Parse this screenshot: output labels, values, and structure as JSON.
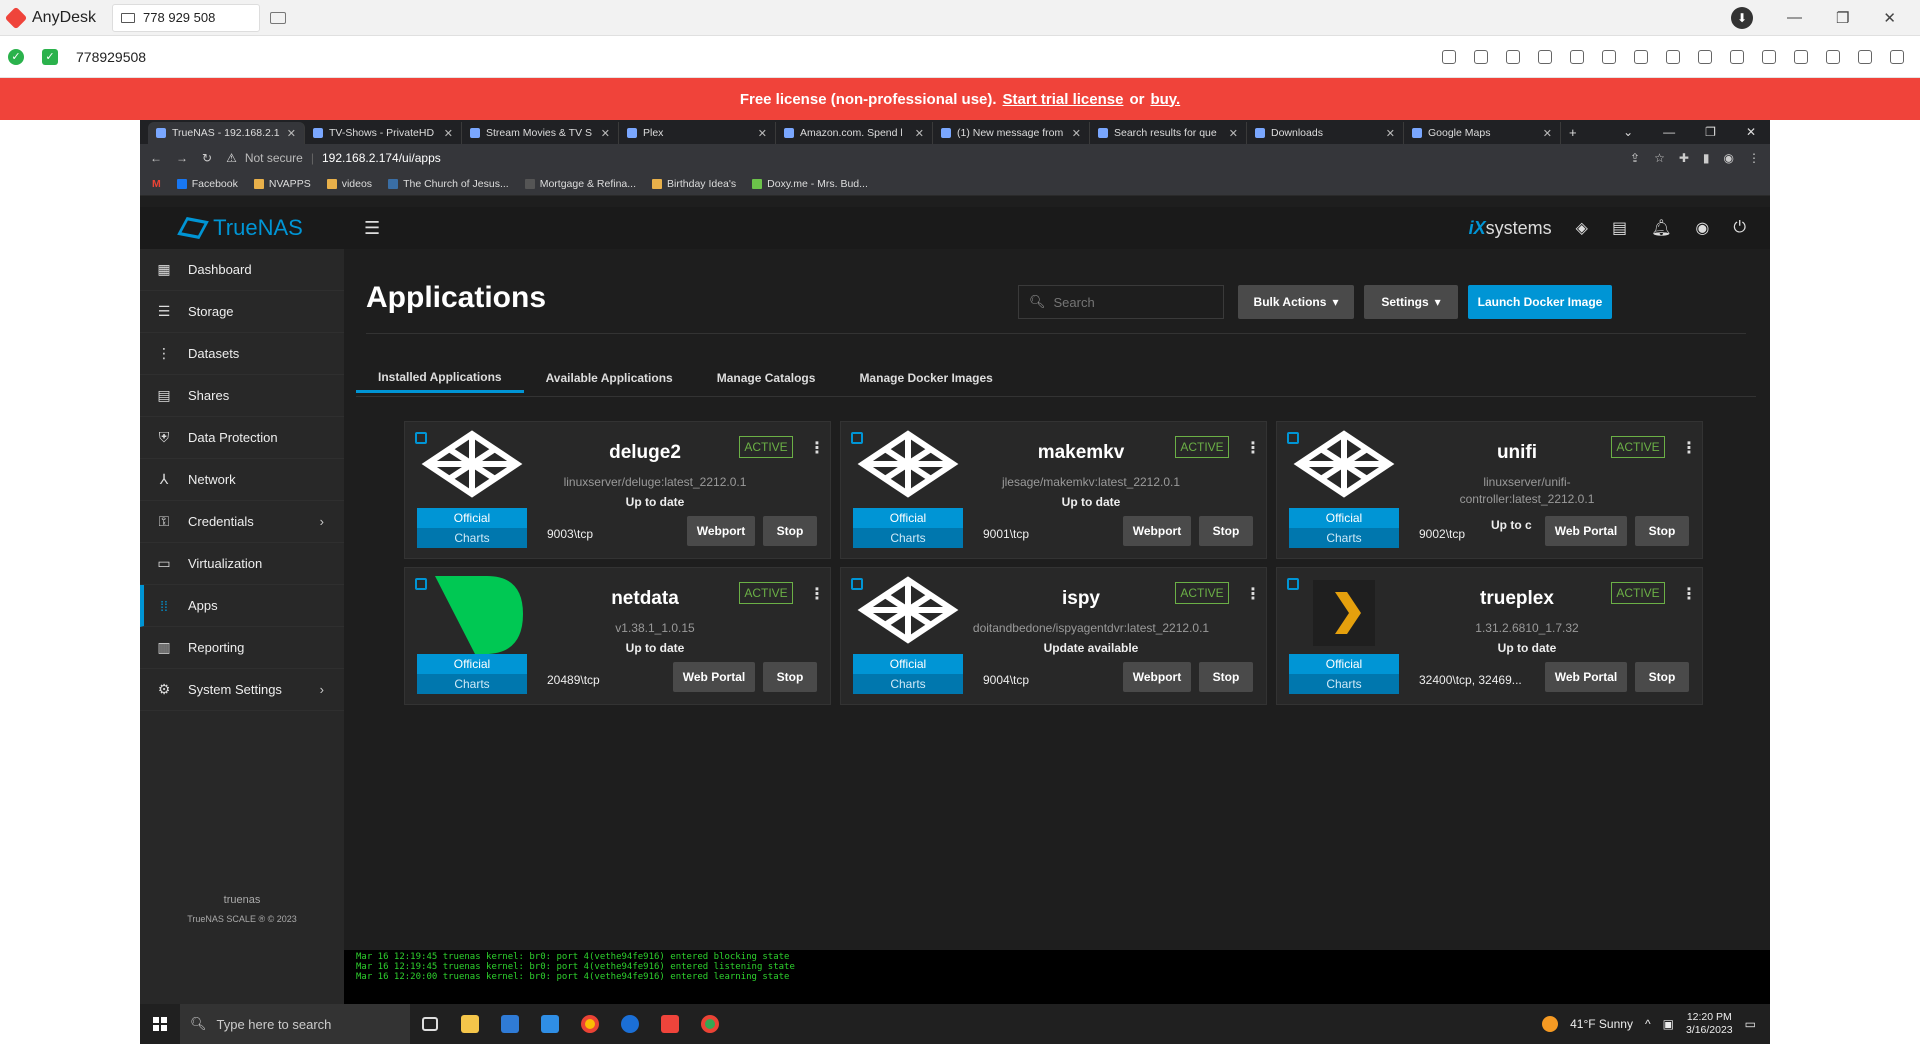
{
  "anydesk": {
    "app_name": "AnyDesk",
    "tab_label": "778 929 508",
    "remote_id": "778929508"
  },
  "license": {
    "text": "Free license (non-professional use).",
    "trial_link": "Start trial license",
    "or": "or",
    "buy_link": "buy."
  },
  "browser": {
    "tabs": [
      {
        "label": "TrueNAS - 192.168.2.1"
      },
      {
        "label": "TV-Shows - PrivateHD"
      },
      {
        "label": "Stream Movies & TV S"
      },
      {
        "label": "Plex"
      },
      {
        "label": "Amazon.com. Spend l"
      },
      {
        "label": "(1) New message from"
      },
      {
        "label": "Search results for que"
      },
      {
        "label": "Downloads"
      },
      {
        "label": "Google Maps"
      }
    ],
    "not_secure": "Not secure",
    "url": "192.168.2.174/ui/apps",
    "bookmarks": [
      "Facebook",
      "NVAPPS",
      "videos",
      "The Church of Jesus...",
      "Mortgage & Refina...",
      "Birthday Idea's",
      "Doxy.me - Mrs. Bud..."
    ]
  },
  "truenas": {
    "brand": "TrueNAS",
    "vendor_prefix": "iX",
    "vendor_suffix": "systems",
    "nav": [
      {
        "label": "Dashboard",
        "icon": "dashboard-icon",
        "glyph": "▦"
      },
      {
        "label": "Storage",
        "icon": "storage-icon",
        "glyph": "☰"
      },
      {
        "label": "Datasets",
        "icon": "datasets-icon",
        "glyph": "⋮"
      },
      {
        "label": "Shares",
        "icon": "shares-icon",
        "glyph": "▤"
      },
      {
        "label": "Data Protection",
        "icon": "shield-icon",
        "glyph": "⛨"
      },
      {
        "label": "Network",
        "icon": "network-icon",
        "glyph": "⅄"
      },
      {
        "label": "Credentials",
        "icon": "key-icon",
        "glyph": "⚿"
      },
      {
        "label": "Virtualization",
        "icon": "monitor-icon",
        "glyph": "▭"
      },
      {
        "label": "Apps",
        "icon": "apps-icon",
        "glyph": "⁞⁞"
      },
      {
        "label": "Reporting",
        "icon": "reporting-icon",
        "glyph": "▥"
      },
      {
        "label": "System Settings",
        "icon": "gear-icon",
        "glyph": "⚙"
      }
    ],
    "sidebar_host": "truenas",
    "copyright": "TrueNAS SCALE ® © 2023"
  },
  "apps_page": {
    "title": "Applications",
    "search_placeholder": "Search",
    "bulk_actions": "Bulk Actions",
    "settings": "Settings",
    "launch_docker": "Launch Docker Image",
    "tabs": [
      "Installed Applications",
      "Available Applications",
      "Manage Catalogs",
      "Manage Docker Images"
    ],
    "badge_official": "Official",
    "badge_charts": "Charts",
    "active_label": "ACTIVE",
    "stop_label": "Stop",
    "apps": [
      {
        "name": "deluge2",
        "image": "linuxserver/deluge:latest_2212.0.1",
        "status": "Up to date",
        "port": "9003\\tcp",
        "portal": "Webport"
      },
      {
        "name": "makemkv",
        "image": "jlesage/makemkv:latest_2212.0.1",
        "status": "Up to date",
        "port": "9001\\tcp",
        "portal": "Webport"
      },
      {
        "name": "unifi",
        "image": "linuxserver/unifi-controller:latest_2212.0.1",
        "status": "Up to c",
        "port": "9002\\tcp",
        "portal": "Web Portal"
      },
      {
        "name": "netdata",
        "image": "v1.38.1_1.0.15",
        "status": "Up to date",
        "port": "20489\\tcp",
        "portal": "Web Portal"
      },
      {
        "name": "ispy",
        "image": "doitandbedone/ispyagentdvr:latest_2212.0.1",
        "status": "Update available",
        "port": "9004\\tcp",
        "portal": "Webport"
      },
      {
        "name": "trueplex",
        "image": "1.31.2.6810_1.7.32",
        "status": "Up to date",
        "port": "32400\\tcp, 32469...",
        "portal": "Web Portal"
      }
    ]
  },
  "console": [
    "Mar 16 12:19:45 truenas kernel: br0: port 4(vethe94fe916) entered blocking state",
    "Mar 16 12:19:45 truenas kernel: br0: port 4(vethe94fe916) entered listening state",
    "Mar 16 12:20:00 truenas kernel: br0: port 4(vethe94fe916) entered learning state"
  ],
  "taskbar": {
    "search_placeholder": "Type here to search",
    "weather": "41°F  Sunny",
    "time": "12:20 PM",
    "date": "3/16/2023"
  }
}
